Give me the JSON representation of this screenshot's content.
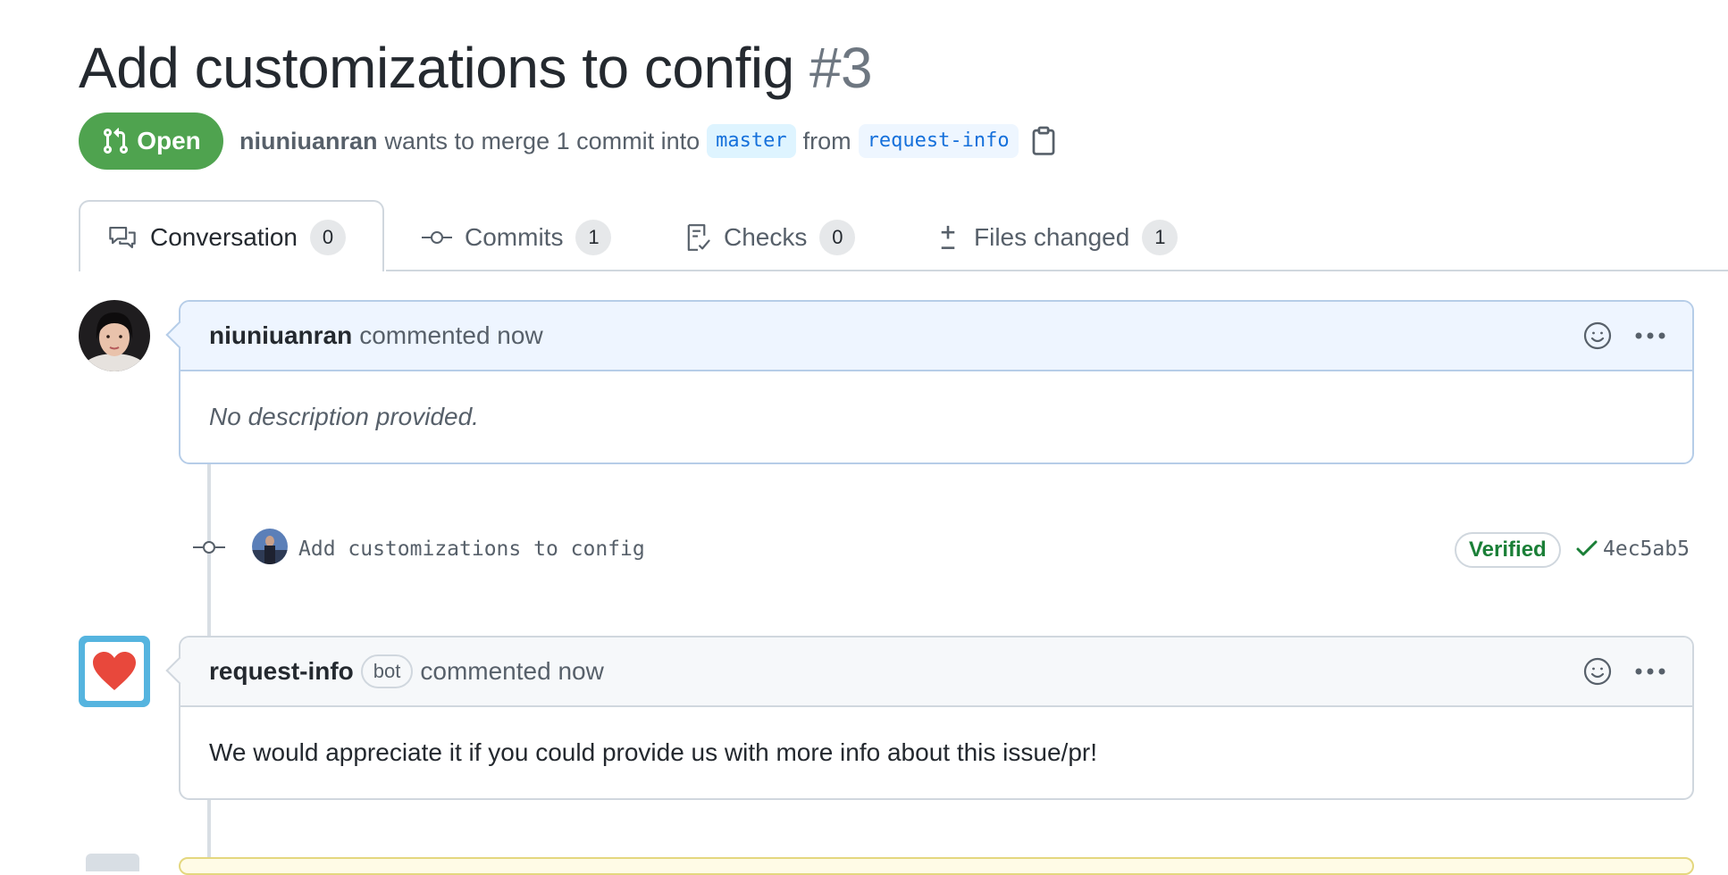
{
  "header": {
    "title": "Add customizations to config",
    "number": "#3",
    "state": "Open",
    "author": "niuniuanran",
    "merge_text": "wants to merge 1 commit into",
    "base_branch": "master",
    "from_text": "from",
    "head_branch": "request-info"
  },
  "tabs": [
    {
      "label": "Conversation",
      "count": "0",
      "icon": "comment-discussion-icon",
      "active": true
    },
    {
      "label": "Commits",
      "count": "1",
      "icon": "git-commit-icon",
      "active": false
    },
    {
      "label": "Checks",
      "count": "0",
      "icon": "checklist-icon",
      "active": false
    },
    {
      "label": "Files changed",
      "count": "1",
      "icon": "file-diff-icon",
      "active": false
    }
  ],
  "timeline": {
    "comment1": {
      "author": "niuniuanran",
      "action": "commented now",
      "body": "No description provided."
    },
    "commit": {
      "message": "Add customizations to config",
      "verified": "Verified",
      "sha": "4ec5ab5"
    },
    "comment2": {
      "author": "request-info",
      "badge": "bot",
      "action": "commented now",
      "body": "We would appreciate it if you could provide us with more info about this issue/pr!"
    }
  },
  "colors": {
    "open_green": "#4fa34f",
    "link_blue": "#0969da",
    "verified_green": "#1a7f37",
    "heart_red": "#e8483c",
    "bot_frame": "#55b4df"
  }
}
